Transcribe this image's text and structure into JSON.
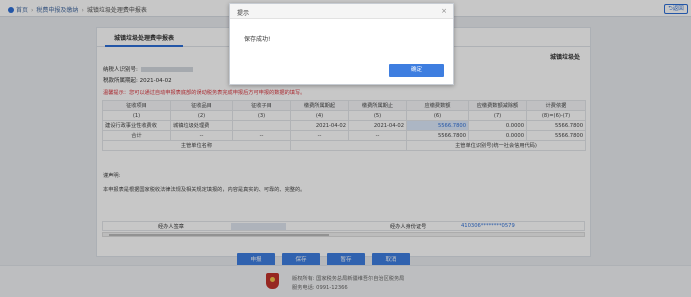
{
  "breadcrumb": {
    "home": "首页",
    "level1": "税费申报及缴纳",
    "current": "城镇垃圾处理费申报表"
  },
  "back_label": "返回",
  "form": {
    "tab_label": "城镇垃圾处理费申报表",
    "side_title": "城镇垃圾处",
    "taxpayer_id_label": "纳税人识别号:",
    "period_label": "税款所属期起:",
    "period_value": "2021-04-02",
    "warning": "温馨提示：您可以通过自动申报表底部的误动税务表完成申报后方可申报的数据的填写。",
    "headers": [
      "征收项目",
      "征收品目",
      "征收子目",
      "缴费所属期起",
      "缴费所属期止",
      "应缴费数额",
      "应缴费数额减除额",
      "计费依据"
    ],
    "codes": [
      "(1)",
      "(2)",
      "(3)",
      "(4)",
      "(5)",
      "(6)",
      "(7)",
      "(8)=(6)-(7)"
    ],
    "row": [
      "建设行政事业性收费收",
      "城镇垃圾处理费",
      "",
      "2021-04-02",
      "2021-04-02",
      "5566.7800",
      "0.0000",
      "5566.7800"
    ],
    "total": [
      "合计",
      "--",
      "--",
      "--",
      "--",
      "5566.7800",
      "0.0000",
      "5566.7800"
    ],
    "unit_name_label": "主管单位名称",
    "unit_code_label": "主管单位识别号(统一社会信用代码)",
    "declaration_title": "谨声明:",
    "declaration_text": "本申报表是根据国家税收法律法规及相关规定填报的，内容是真实的、可靠的、完整的。",
    "agent_label": "经办人签章",
    "agent_id_label": "经办人身份证号",
    "agent_id_value": "410306********0579"
  },
  "buttons": {
    "declare": "申报",
    "save": "保存",
    "temp_save": "暂存",
    "cancel": "取消"
  },
  "footer": {
    "line1": "版权所有: 国家税务总局新疆维吾尔自治区税务局",
    "line2": "服务电话: 0991-12366"
  },
  "dialog": {
    "title": "提示",
    "message": "保存成功!",
    "ok_label": "确定",
    "close_glyph": "×"
  }
}
